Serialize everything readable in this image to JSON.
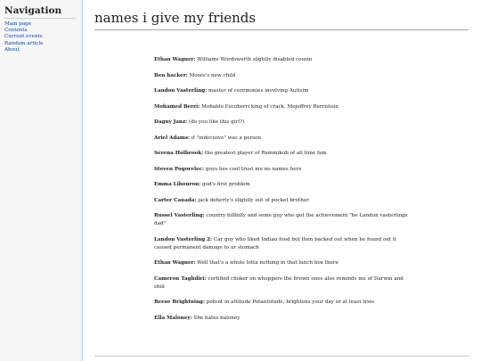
{
  "sidebar": {
    "heading": "Navigation",
    "items": [
      {
        "label": "Main page"
      },
      {
        "label": "Contents"
      },
      {
        "label": "Current events"
      },
      {
        "label": "Random article"
      },
      {
        "label": "About"
      }
    ]
  },
  "main": {
    "title": "names i give my friends",
    "entries": [
      {
        "name": "Ethan Wagner:",
        "desc": " Williams Wordsworth slightly disabled cousin"
      },
      {
        "name": "Ben hacker:",
        "desc": " Moses's new child"
      },
      {
        "name": "Landon Vasterling:",
        "desc": " master of ceremonies involving Autisim"
      },
      {
        "name": "Mohamed Berri:",
        "desc": " Mohablo Escoberri king of crack. Mojeffrey Berristein"
      },
      {
        "name": "Dagny Janz:",
        "desc": " (do you like this girl?)"
      },
      {
        "name": "Ariel Adams:",
        "desc": " if \"indecisive\" was a person"
      },
      {
        "name": "Serena Holbrook:",
        "desc": " the greatest player of Rummikub of all time fam"
      },
      {
        "name": "Steven Pogorelec:",
        "desc": " guys hes cool trust me no names here"
      },
      {
        "name": "Emma Libouron:",
        "desc": " god's first problem"
      },
      {
        "name": "Carter Canada:",
        "desc": " jack doherty's slightly out of pocket brother"
      },
      {
        "name": "Russel Vasterling:",
        "desc": " country hillbilly and some guy who got the achievement \"be Landon vasterlings dad\""
      },
      {
        "name": "Landon Vasterling 2:",
        "desc": " Car guy who liked Indian food but then backed out when he found out it caused permanent damage to ur stomach"
      },
      {
        "name": "Ethan Wagner:",
        "desc": " Well that's a whole lotta nothing in that lunch box there"
      },
      {
        "name": "Cameron Taghdiri:",
        "desc": " certified choker on whoppers the brown ones also reminds me of Darwin and shiii"
      },
      {
        "name": "Reese Brightning:",
        "desc": " potent in attitude Potantotude, brightens your day or at least tries"
      },
      {
        "name": "Ella Maloney:",
        "desc": " She hates baloney"
      }
    ]
  }
}
